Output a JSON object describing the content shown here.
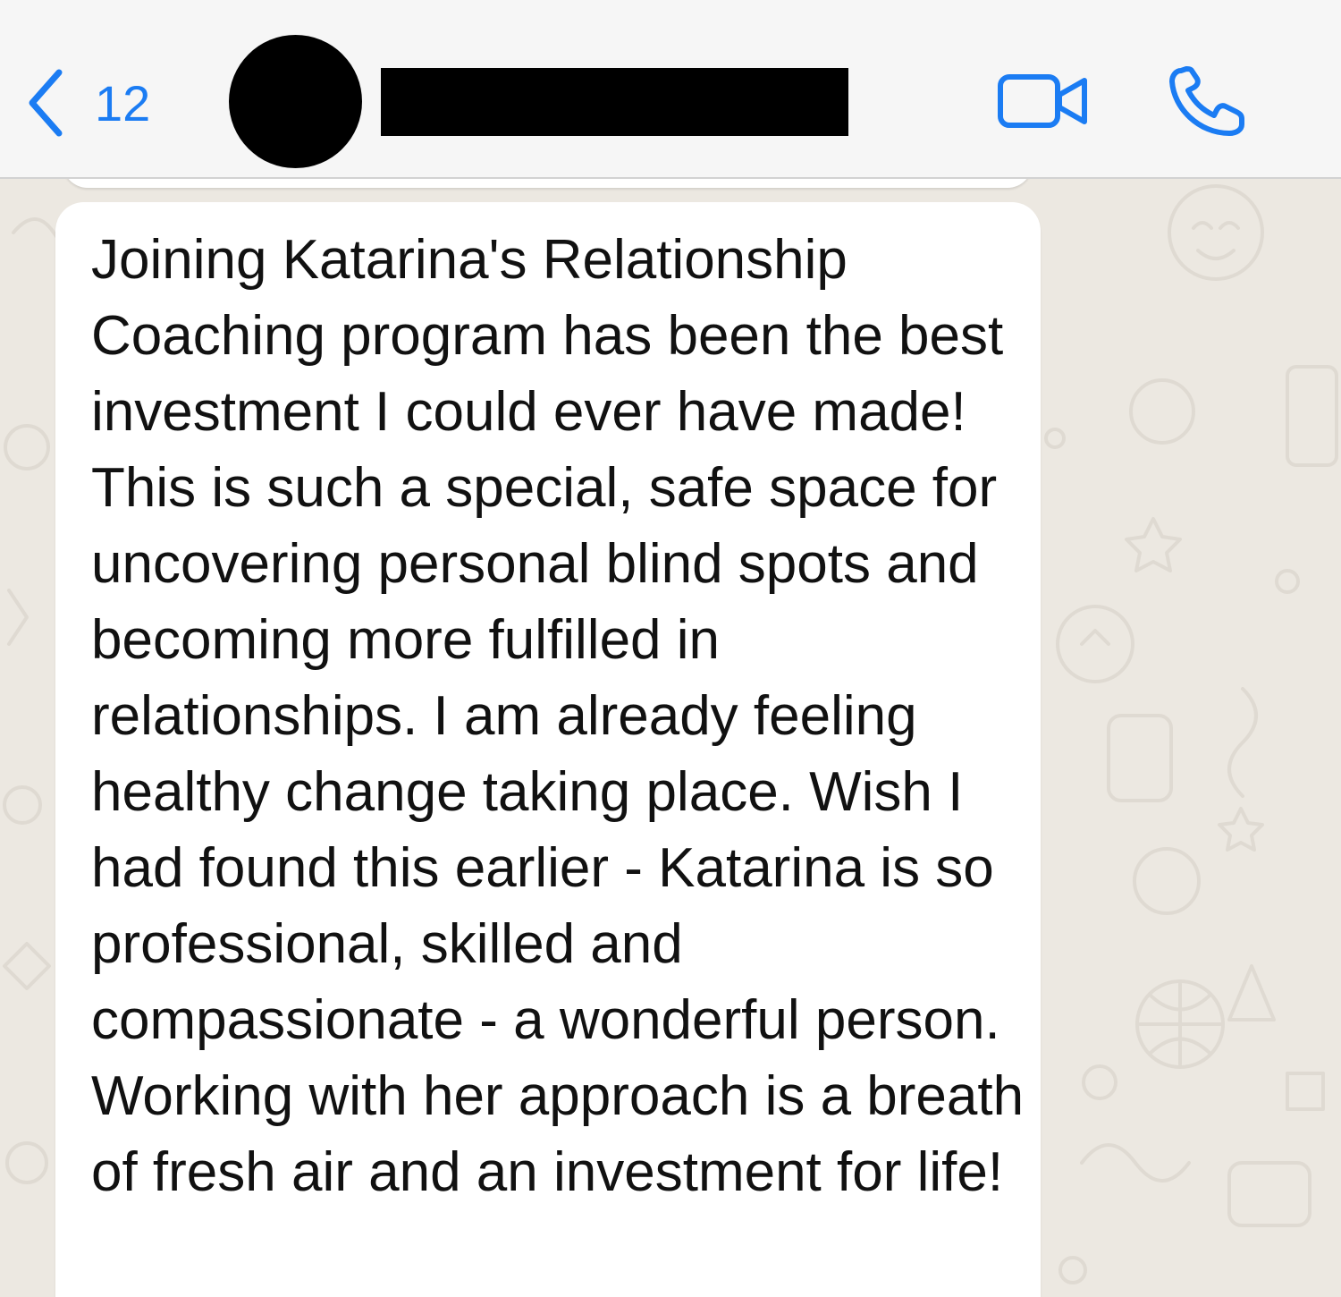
{
  "header": {
    "back_count": "12",
    "contact_name": "",
    "icons": {
      "back": "chevron-left-icon",
      "video": "video-camera-icon",
      "call": "phone-icon"
    },
    "accent_color": "#1B7CF3"
  },
  "chat": {
    "wallpaper_color": "#ECE8E1",
    "bubble_color": "#FFFFFF",
    "message": {
      "text": "Joining Katarina's Relationship Coaching program has been the best investment I could ever have made! This is such a special, safe space for uncovering personal blind spots and becoming more fulfilled in relationships. I am already feeling healthy change taking place. Wish I had found this earlier - Katarina is so professional, skilled and compassionate - a wonderful person. Working with her approach is a breath of fresh air and an investment for life!"
    }
  }
}
